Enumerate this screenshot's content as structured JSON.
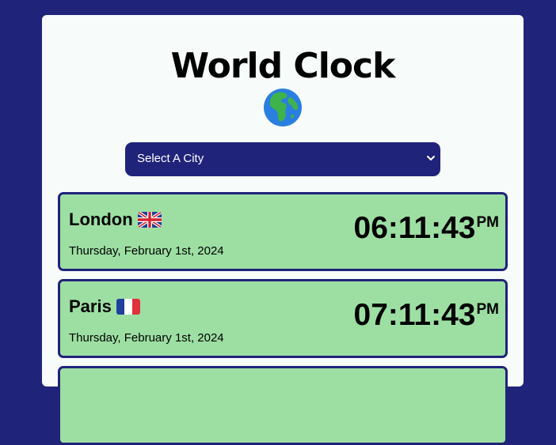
{
  "page": {
    "title": "World Clock",
    "globe_icon": "globe-europe-africa-icon"
  },
  "city_select": {
    "selected_label": "Select A City",
    "chevron_icon": "chevron-down-icon"
  },
  "cities": [
    {
      "name": "London",
      "flag_icon": "uk-flag-icon",
      "date": "Thursday, February 1st, 2024",
      "time": "06:11:43",
      "ampm": "PM"
    },
    {
      "name": "Paris",
      "flag_icon": "france-flag-icon",
      "date": "Thursday, February 1st, 2024",
      "time": "07:11:43",
      "ampm": "PM"
    }
  ],
  "colors": {
    "background": "#20237a",
    "card": "#f7fbfa",
    "row_fill": "#9ddfa3",
    "row_border": "#20237a"
  }
}
